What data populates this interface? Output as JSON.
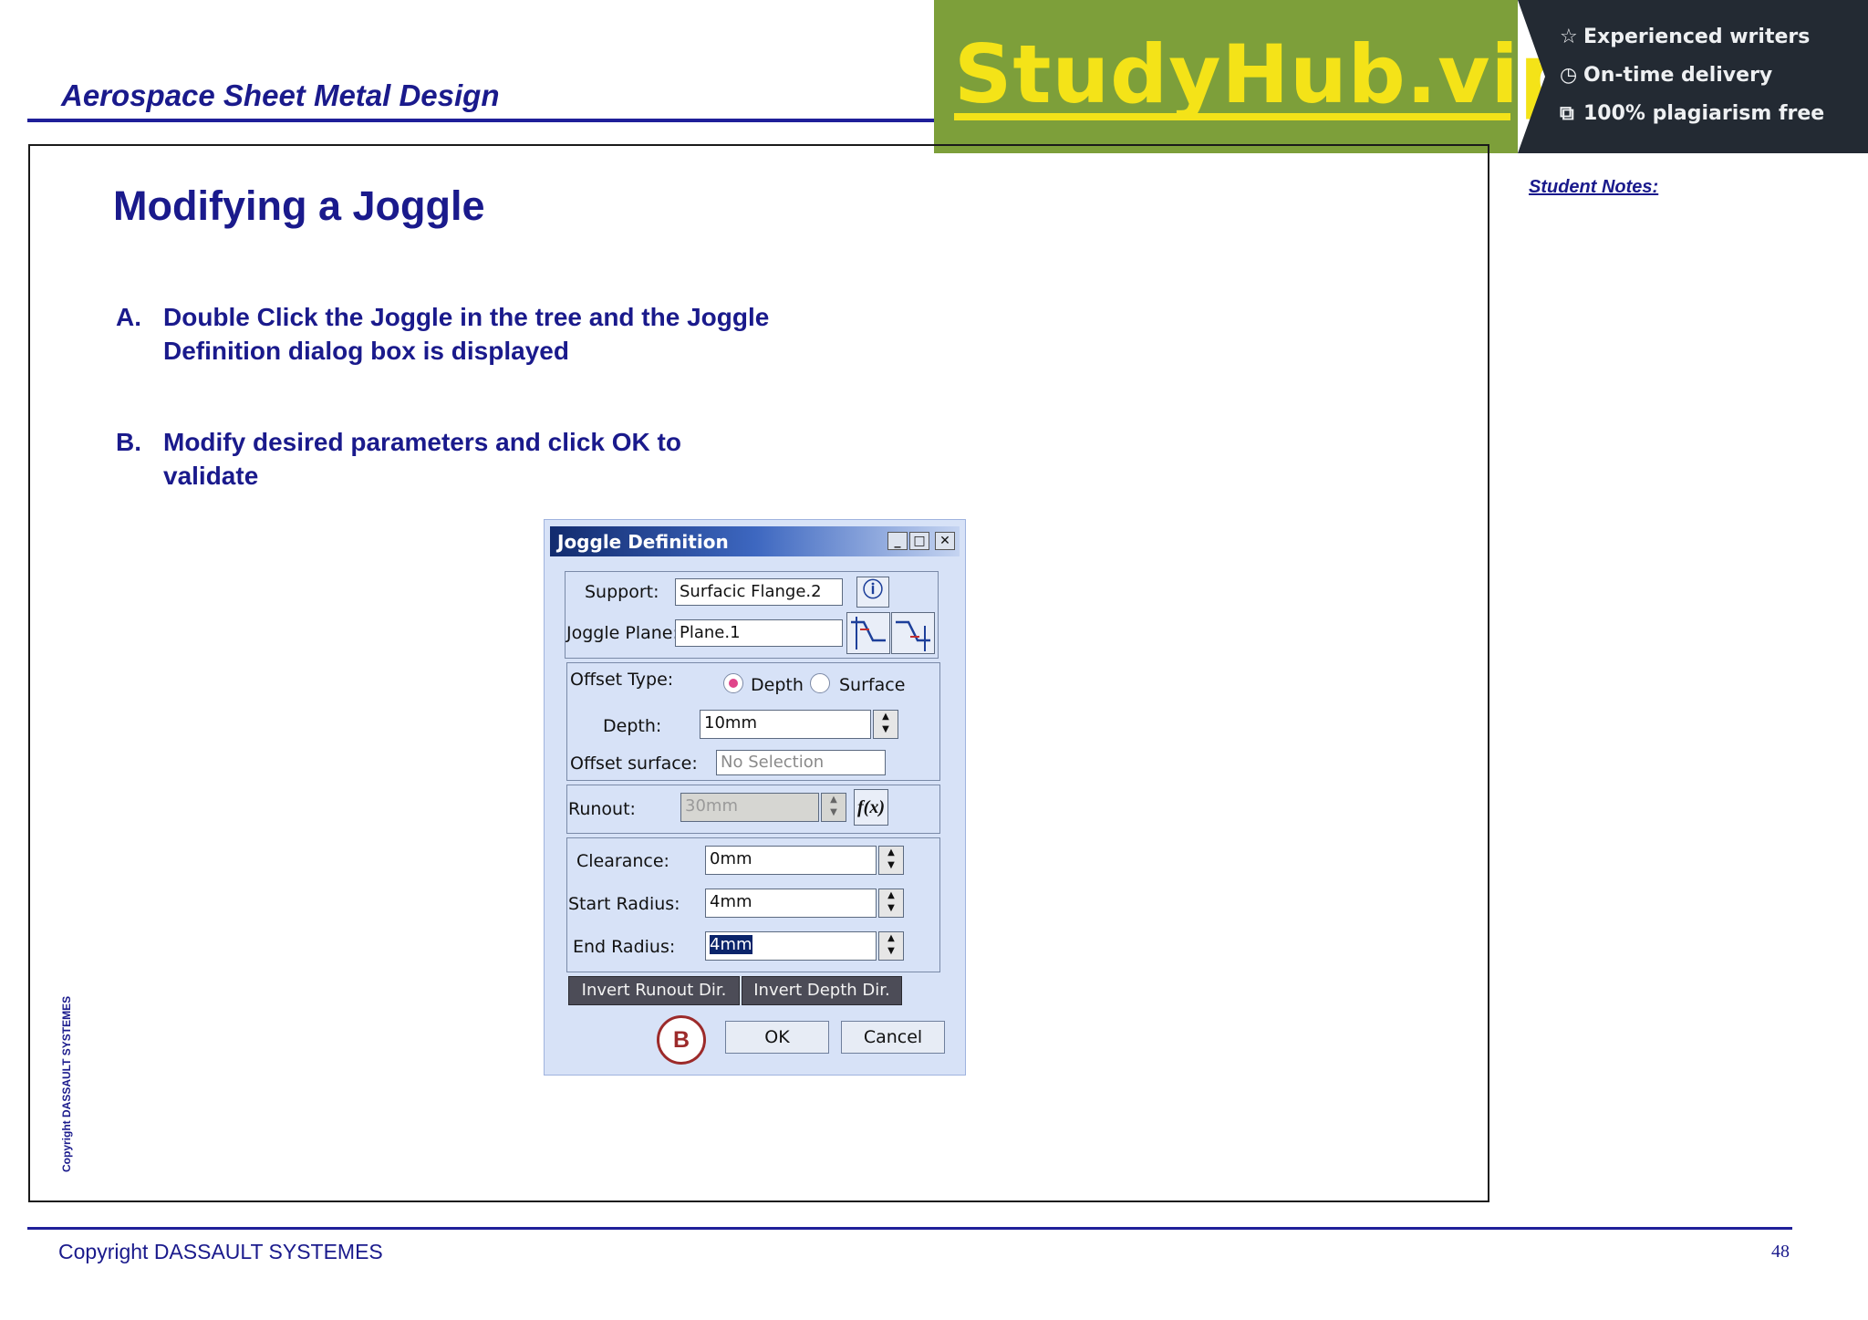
{
  "header": {
    "course_title": "Aerospace Sheet Metal Design"
  },
  "banner": {
    "logo": "StudyHub.vip",
    "features": [
      {
        "icon": "star-icon",
        "glyph": "☆",
        "label": "Experienced writers"
      },
      {
        "icon": "clock-icon",
        "glyph": "◷",
        "label": "On-time delivery"
      },
      {
        "icon": "copy-icon",
        "glyph": "⧉",
        "label": "100% plagiarism free"
      }
    ]
  },
  "slide": {
    "heading": "Modifying a Joggle",
    "steps": [
      {
        "letter": "A.",
        "text": "Double Click the Joggle in the tree and the Joggle Definition dialog box is displayed"
      },
      {
        "letter": "B.",
        "text": "Modify desired parameters and click OK to validate"
      }
    ],
    "student_notes": "Student Notes:",
    "side_copyright": "Copyright DASSAULT SYSTEMES"
  },
  "dialog": {
    "title": "Joggle Definition",
    "titlebar_buttons": {
      "minimize": "_",
      "maximize": "□",
      "close": "✕"
    },
    "support": {
      "label": "Support:",
      "value": "Surfacic Flange.2"
    },
    "joggle_plane": {
      "label": "Joggle Plane:",
      "value": "Plane.1"
    },
    "offset_type": {
      "label": "Offset Type:",
      "options": [
        "Depth",
        "Surface"
      ],
      "selected": "Depth"
    },
    "depth": {
      "label": "Depth:",
      "value": "10mm"
    },
    "offset_surface": {
      "label": "Offset surface:",
      "value": "No Selection"
    },
    "runout": {
      "label": "Runout:",
      "value": "30mm",
      "formula": "f(x)"
    },
    "clearance": {
      "label": "Clearance:",
      "value": "0mm"
    },
    "start_radius": {
      "label": "Start Radius:",
      "value": "4mm"
    },
    "end_radius": {
      "label": "End Radius:",
      "value": "4mm"
    },
    "invert_runout": "Invert Runout Dir.",
    "invert_depth": "Invert Depth Dir.",
    "ok": "OK",
    "cancel": "Cancel",
    "callout": "B"
  },
  "footer": {
    "copyright": "Copyright DASSAULT SYSTEMES",
    "page": "48"
  },
  "colors": {
    "title_blue": "#1a1a8c",
    "banner_green": "#7d9f3a",
    "banner_dark": "#232a33",
    "logo_yellow": "#f4e318",
    "callout_red": "#9c2a2a"
  }
}
